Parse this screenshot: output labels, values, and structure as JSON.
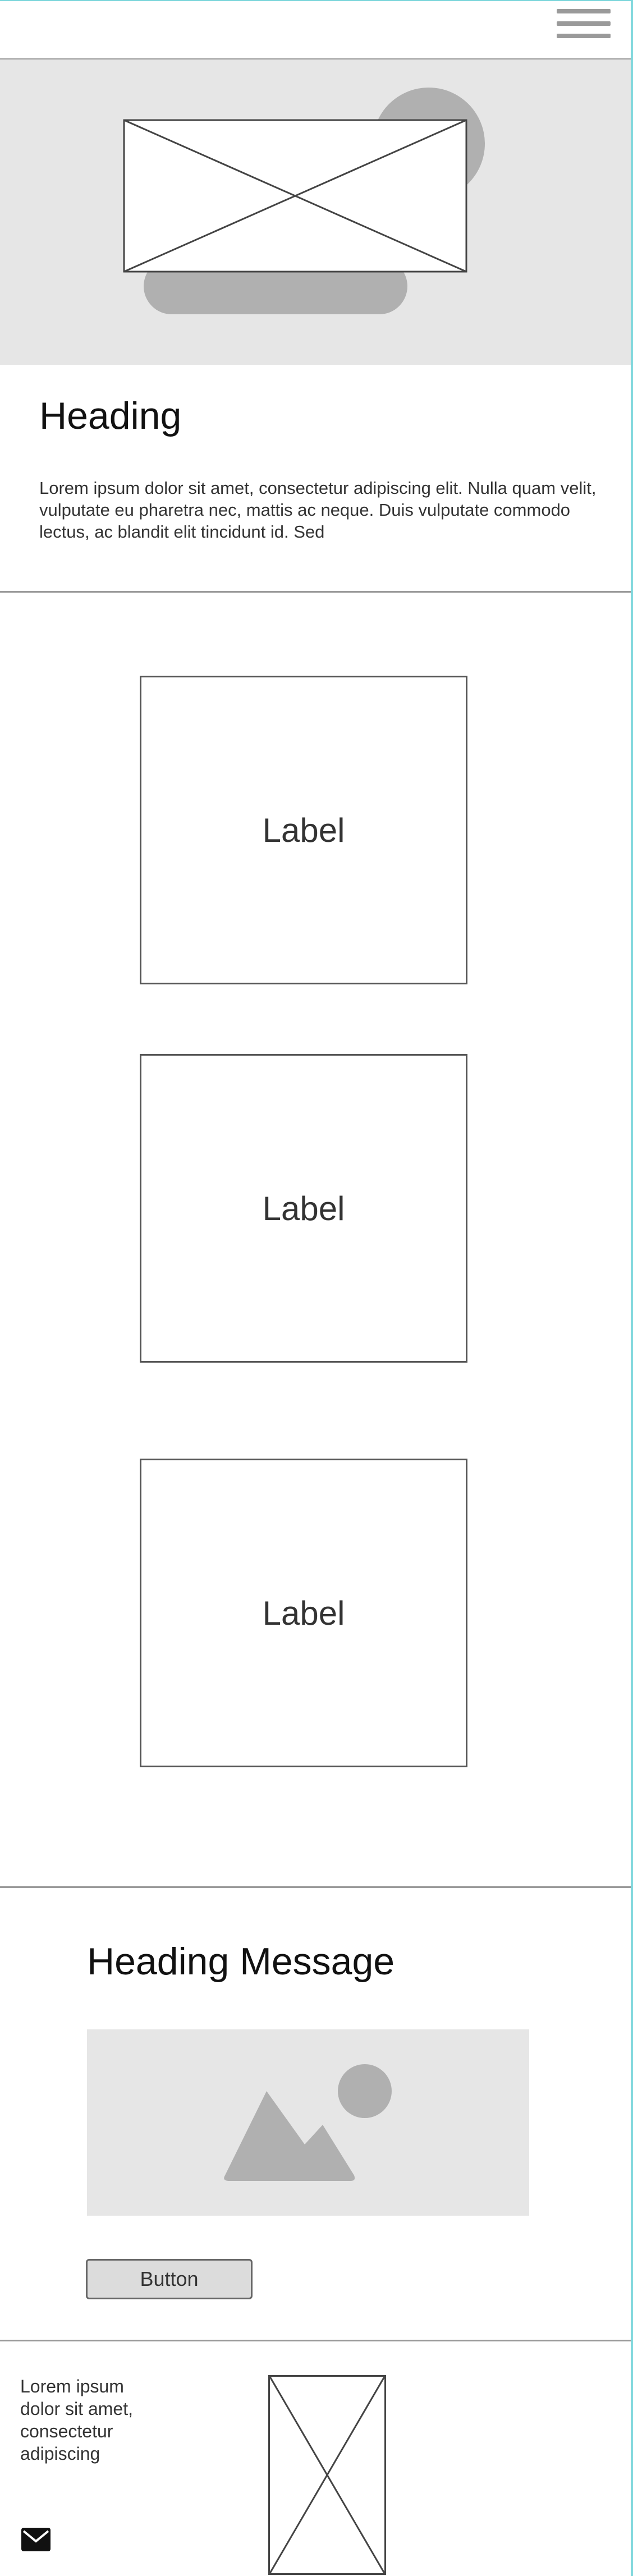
{
  "header": {
    "menu_icon": "hamburger-icon"
  },
  "hero": {
    "image_icon": "image-placeholder-icon"
  },
  "intro": {
    "heading": "Heading",
    "body": "Lorem ipsum dolor sit amet, consectetur adipiscing elit. Nulla quam velit, vulputate eu pharetra nec, mattis ac neque. Duis vulputate commodo lectus, ac blandit elit tincidunt id. Sed"
  },
  "cards": [
    {
      "label": "Label"
    },
    {
      "label": "Label"
    },
    {
      "label": "Label"
    }
  ],
  "message": {
    "heading": "Heading Message",
    "image_icon": "landscape-image-icon",
    "button_label": "Button"
  },
  "footer": {
    "text": "Lorem ipsum dolor sit amet, consectetur adipiscing",
    "image_icon": "image-placeholder-icon",
    "mail_icon": "mail-icon"
  },
  "colors": {
    "placeholder_bg": "#e6e6e6",
    "shape_gray": "#b0b0b0",
    "divider": "#9a9a9a",
    "edge_accent": "#7fd7dc"
  }
}
